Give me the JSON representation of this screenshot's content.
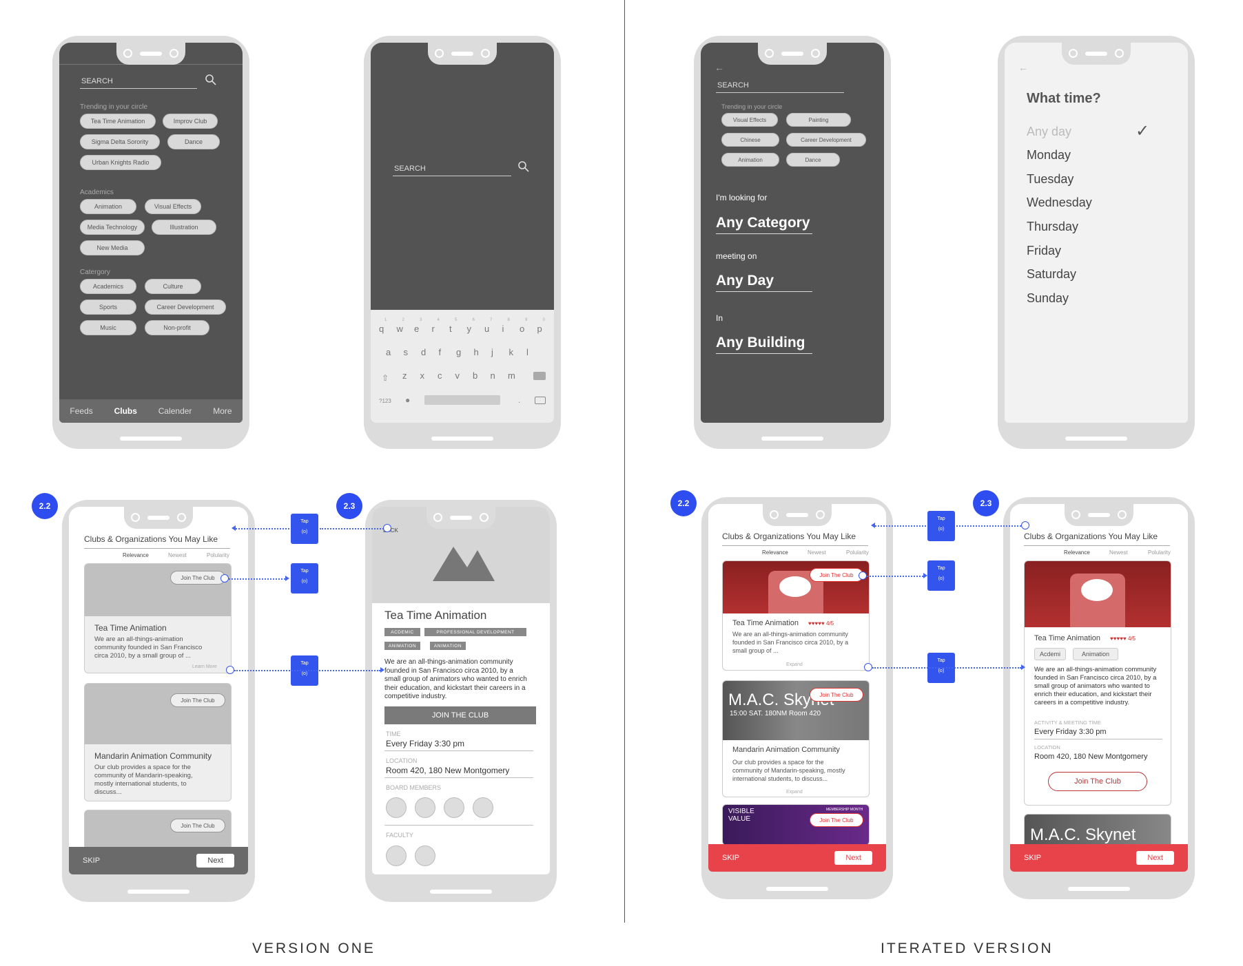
{
  "captions": {
    "left": "VERSION ONE",
    "right": "ITERATED VERSION"
  },
  "p1": {
    "search": "SEARCH",
    "trending_label": "Trending in your circle",
    "trending": [
      "Tea Time Animation",
      "Improv Club",
      "Sigma Delta Sorority",
      "Dance",
      "Urban Knights Radio"
    ],
    "academics_label": "Academics",
    "academics": [
      "Animation",
      "Visual Effects",
      "Media Technology",
      "Illustration",
      "New Media"
    ],
    "category_label": "Catergory",
    "category": [
      "Academics",
      "Culture",
      "Sports",
      "Career Development",
      "Music",
      "Non-profit"
    ],
    "tabs": [
      "Feeds",
      "Clubs",
      "Calender",
      "More"
    ]
  },
  "p2": {
    "search": "SEARCH",
    "row1": [
      "q",
      "w",
      "e",
      "r",
      "t",
      "y",
      "u",
      "i",
      "o",
      "p"
    ],
    "row1_nums": [
      "1",
      "2",
      "3",
      "4",
      "5",
      "6",
      "7",
      "8",
      "9",
      "0"
    ],
    "row2": [
      "a",
      "s",
      "d",
      "f",
      "g",
      "h",
      "j",
      "k",
      "l"
    ],
    "row3": [
      "z",
      "x",
      "c",
      "v",
      "b",
      "n",
      "m"
    ],
    "sym": "?123",
    "dot": "."
  },
  "p3": {
    "back": "←",
    "search": "SEARCH",
    "trending_label": "Trending in your circle",
    "trending": [
      "Visual Effects",
      "Painting",
      "Chinese",
      "Career Development",
      "Animation",
      "Dance"
    ],
    "looking_label": "I'm looking for",
    "looking_value": "Any Category",
    "meeting_label": "meeting on",
    "meeting_value": "Any Day",
    "in_label": "In",
    "in_value": "Any Building"
  },
  "p4": {
    "back": "←",
    "title": "What time?",
    "days": [
      "Any day",
      "Monday",
      "Tuesday",
      "Wednesday",
      "Thursday",
      "Friday",
      "Saturday",
      "Sunday"
    ],
    "check": "✓"
  },
  "p5": {
    "badge": "2.2",
    "title": "Clubs & Organizations You May Like",
    "sort": [
      "Relevance",
      "Newest",
      "Polularity"
    ],
    "join": "Join The Club",
    "card1_title": "Tea Time Animation",
    "card1_desc": "We are an all-things-animation community founded in San Francisco circa 2010, by a small group of ...",
    "learn_more": "Learn More",
    "card2_title": "Mandarin Animation Community",
    "card2_desc": "Our club provides a space for the community of Mandarin-speaking, mostly international students, to discuss...",
    "skip": "SKIP",
    "next": "Next"
  },
  "p6": {
    "badge": "2.3",
    "back": "BACK",
    "title": "Tea Time Animation",
    "tags": [
      "ACDEMIC",
      "PROFESSIONAL DEVELOPMENT",
      "ANIMATION",
      "ANIMATION"
    ],
    "desc": "We are an all-things-animation community founded in San Francisco circa 2010, by a small group of animators who wanted to enrich their education, and kickstart their careers in a competitive industry.",
    "join": "JOIN THE CLUB",
    "time_label": "TIME",
    "time_value": "Every Friday 3:30 pm",
    "loc_label": "LOCATION",
    "loc_value": "Room 420, 180 New Montgomery",
    "board_label": "BOARD MEMBERS",
    "faculty_label": "FACULTY"
  },
  "p7": {
    "badge": "2.2",
    "title": "Clubs & Organizations You May Like",
    "sort": [
      "Relevance",
      "Newest",
      "Polularity"
    ],
    "join": "Join The Club",
    "card1_title": "Tea Time Animation",
    "rating": "♥♥♥♥♥ 4/5",
    "card1_desc": "We are an all-things-animation community founded in San Francisco circa 2010, by a small group of ...",
    "expand": "Expand",
    "card2_img_title": "M.A.C. Skynet",
    "card2_img_sub": "15:00 SAT. 180NM Room 420",
    "card2_title": "Mandarin Animation Community",
    "card2_desc": "Our club provides a space for the community of Mandarin-speaking, mostly international students, to discuss...",
    "card3_img_title": "VISIBLE VALUE",
    "card3_img_sub": "MEMBERSHIP MONTH",
    "skip": "SKIP",
    "next": "Next"
  },
  "p8": {
    "badge": "2.3",
    "title": "Clubs & Organizations You May Like",
    "sort": [
      "Relevance",
      "Newest",
      "Polularity"
    ],
    "card_title": "Tea Time Animation",
    "rating": "♥♥♥♥♥ 4/5",
    "chips": [
      "Acdemi",
      "Animation"
    ],
    "desc": "We are an all-things-animation community founded in San Francisco circa 2010, by a small group of animators who wanted to enrich their education, and kickstart their careers in a competitive industry.",
    "time_label": "ACTIVITY & MEETING TIME",
    "time_value": "Every Friday 3:30 pm",
    "loc_label": "LOCATION",
    "loc_value": "Room 420, 180 New Montgomery",
    "join": "Join The Club",
    "card2_img_title": "M.A.C. Skynet",
    "skip": "SKIP",
    "next": "Next"
  },
  "tap": {
    "label": "Tap",
    "sub": "(o)"
  },
  "colors": {
    "dark_screen": "#535353",
    "accent_red": "#e8434a",
    "blue": "#2e4df0"
  }
}
